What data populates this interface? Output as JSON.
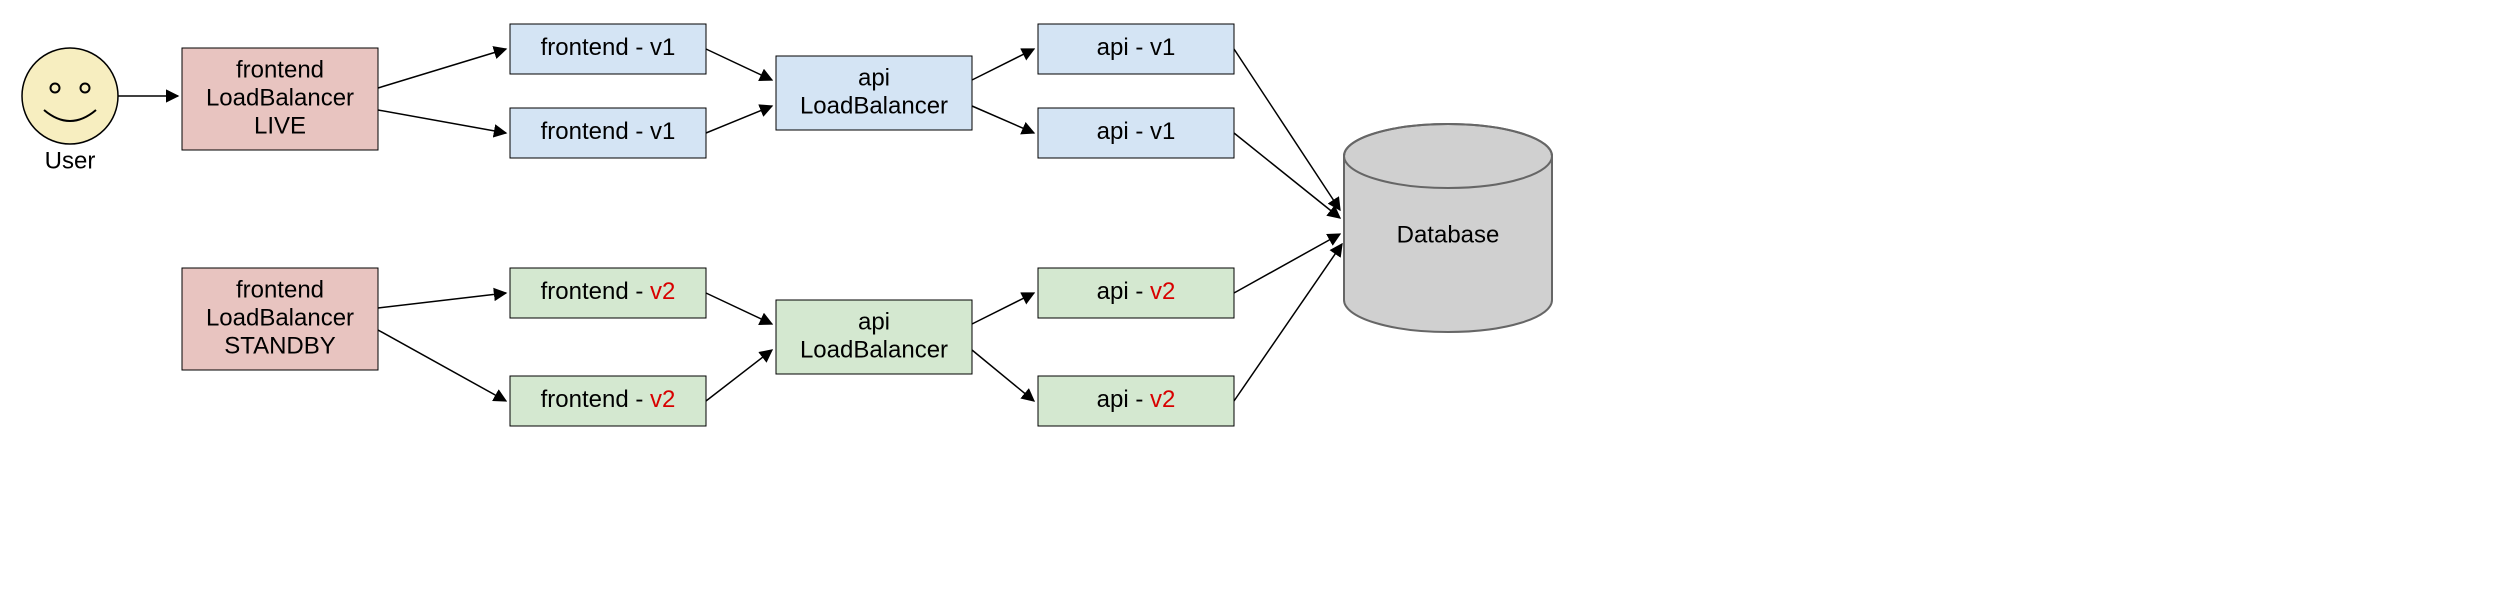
{
  "user": {
    "label": "User"
  },
  "colors": {
    "pink": "#e8c4c0",
    "pink_stroke": "#aa7a76",
    "blue": "#d4e4f4",
    "blue_stroke": "#8aa8c6",
    "green": "#d4e8d0",
    "green_stroke": "#8fb087",
    "gray": "#d0d0d0",
    "gray_stroke": "#888888",
    "face": "#f7eec0",
    "face_stroke": "#000000"
  },
  "live": {
    "lb_frontend": {
      "line1": "frontend",
      "line2": "LoadBalancer",
      "line3": "LIVE"
    },
    "frontend_nodes": [
      {
        "prefix": "frontend - ",
        "version": "v1"
      },
      {
        "prefix": "frontend - ",
        "version": "v1"
      }
    ],
    "lb_api": {
      "line1": "api",
      "line2": "LoadBalancer"
    },
    "api_nodes": [
      {
        "prefix": "api - ",
        "version": "v1"
      },
      {
        "prefix": "api - ",
        "version": "v1"
      }
    ]
  },
  "standby": {
    "lb_frontend": {
      "line1": "frontend",
      "line2": "LoadBalancer",
      "line3": "STANDBY"
    },
    "frontend_nodes": [
      {
        "prefix": "frontend - ",
        "version": "v2"
      },
      {
        "prefix": "frontend - ",
        "version": "v2"
      }
    ],
    "lb_api": {
      "line1": "api",
      "line2": "LoadBalancer"
    },
    "api_nodes": [
      {
        "prefix": "api - ",
        "version": "v2"
      },
      {
        "prefix": "api - ",
        "version": "v2"
      }
    ]
  },
  "database": {
    "label": "Database"
  }
}
